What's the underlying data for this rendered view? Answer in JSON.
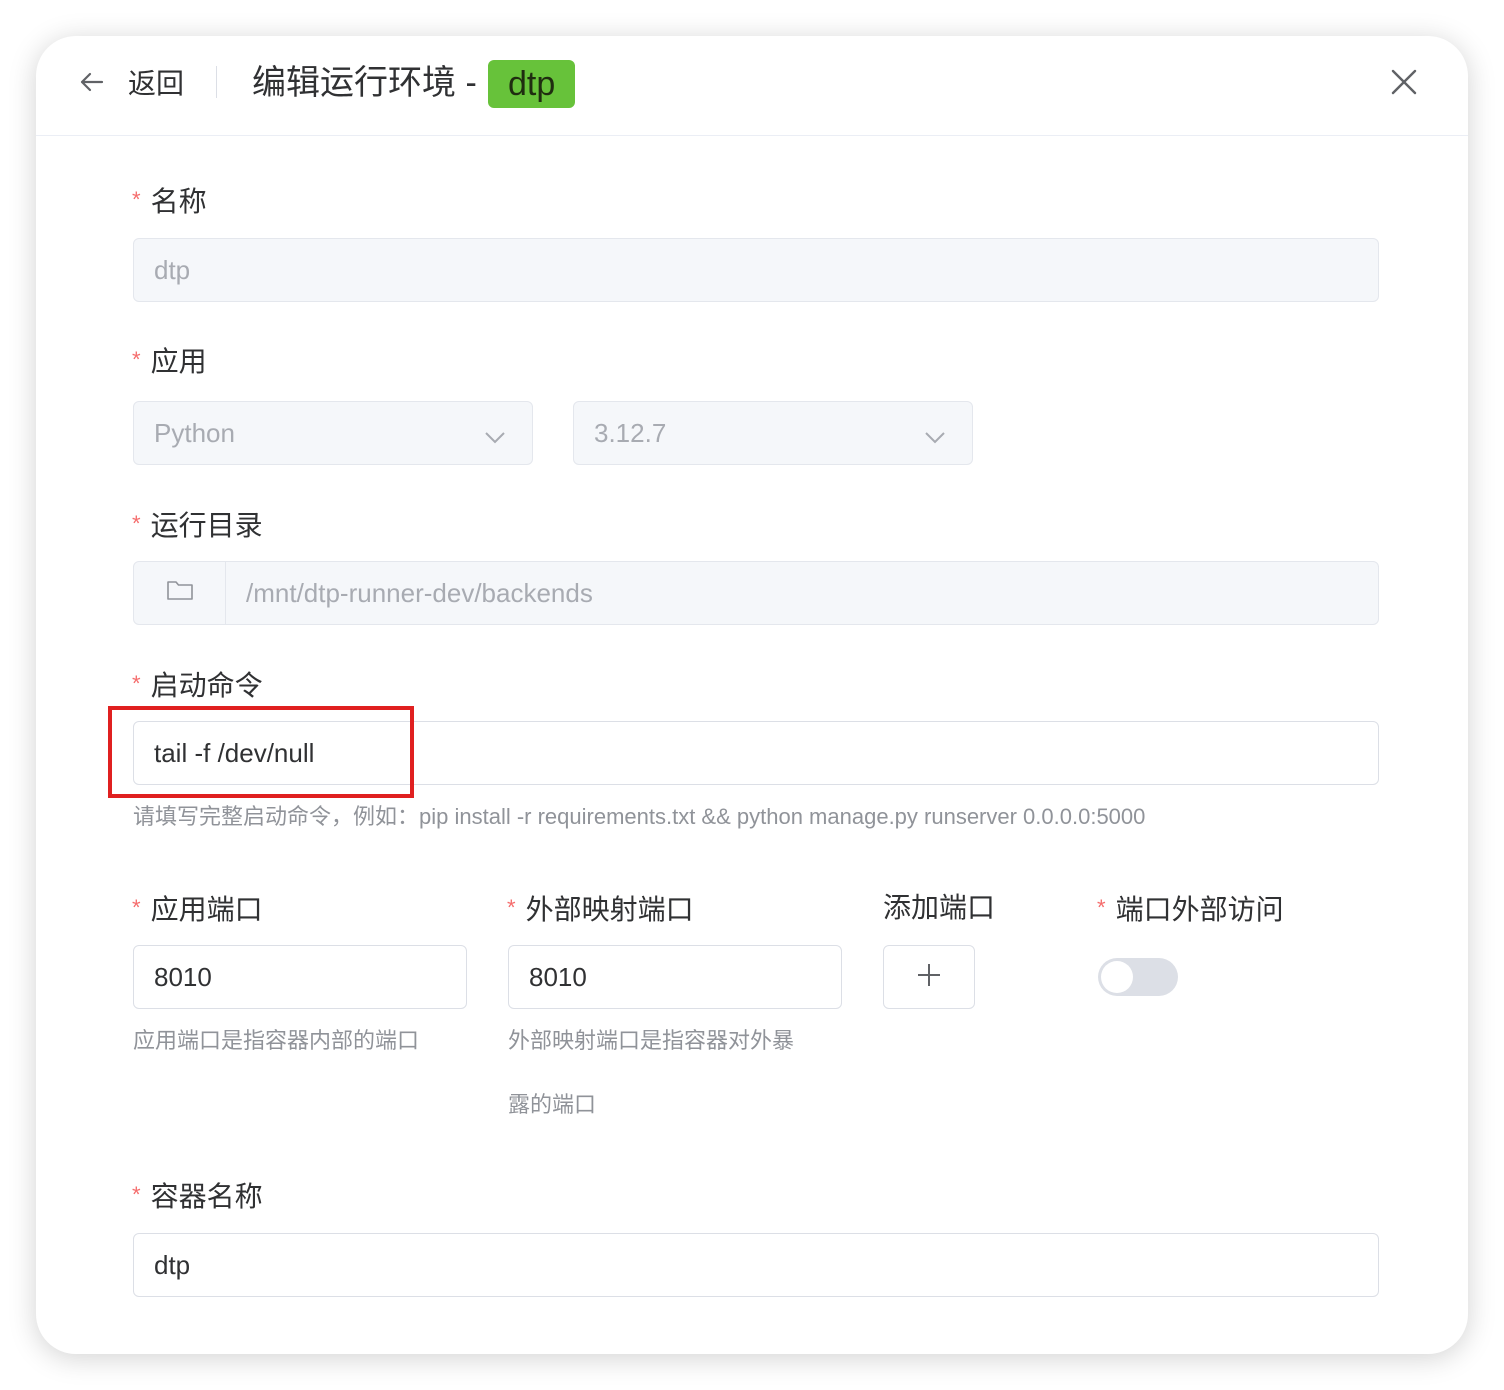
{
  "header": {
    "back_label": "返回",
    "title": "编辑运行环境 -",
    "tag": "dtp"
  },
  "form": {
    "name": {
      "required": "*",
      "label": "名称",
      "value": "dtp"
    },
    "app": {
      "required": "*",
      "label": "应用",
      "runtime": "Python",
      "version": "3.12.7"
    },
    "run_dir": {
      "required": "*",
      "label": "运行目录",
      "value": "/mnt/dtp-runner-dev/backends"
    },
    "command": {
      "required": "*",
      "label": "启动命令",
      "value": "tail -f /dev/null",
      "hint": "请填写完整启动命令，例如：pip install -r requirements.txt && python manage.py runserver 0.0.0.0:5000"
    },
    "app_port": {
      "required": "*",
      "label": "应用端口",
      "value": "8010",
      "hint": "应用端口是指容器内部的端口"
    },
    "external_port": {
      "required": "*",
      "label": "外部映射端口",
      "value": "8010",
      "hint_line1": "外部映射端口是指容器对外暴",
      "hint_line2": "露的端口"
    },
    "add_port": {
      "label": "添加端口",
      "icon": "plus-icon"
    },
    "external_access": {
      "required": "*",
      "label": "端口外部访问",
      "enabled": false
    },
    "container_name": {
      "required": "*",
      "label": "容器名称",
      "value": "dtp"
    }
  },
  "colors": {
    "tag_bg": "#67c23a",
    "required": "#f56c6c",
    "highlight": "#e02020"
  }
}
